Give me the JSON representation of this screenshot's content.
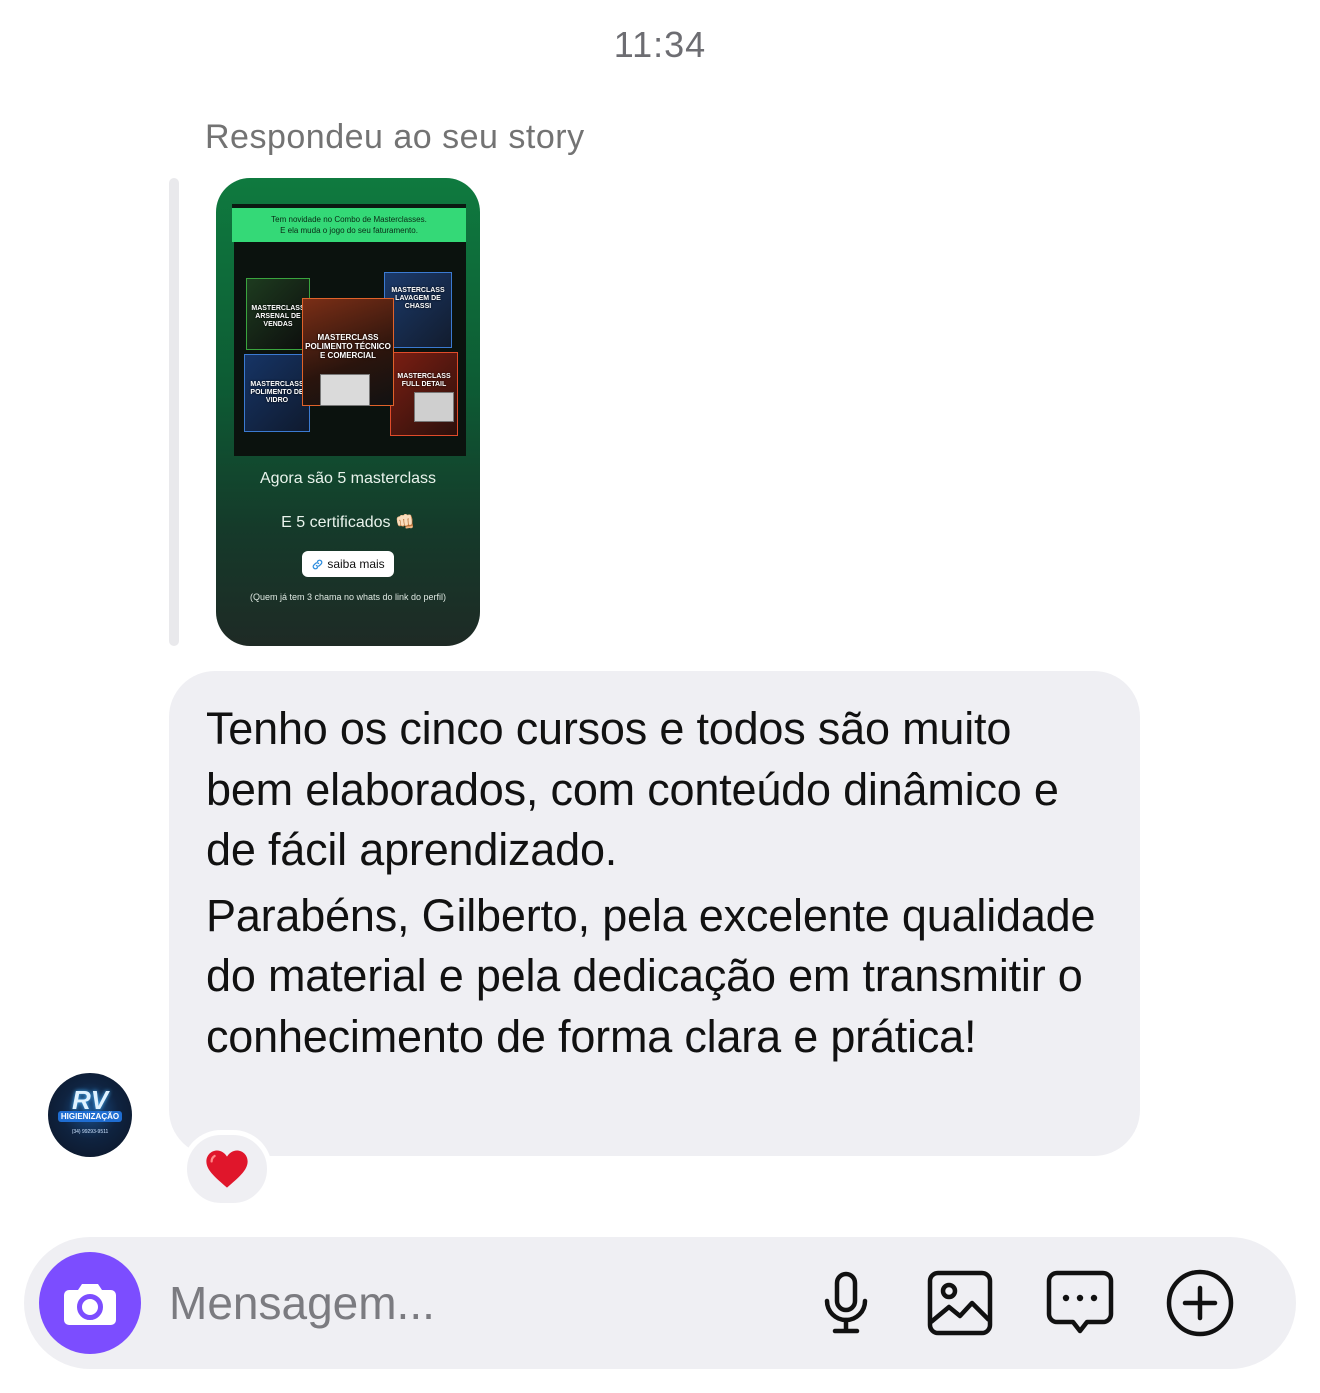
{
  "header": {
    "time": "11:34"
  },
  "thread": {
    "reply_context": "Respondeu ao seu story",
    "story": {
      "banner_line1": "Tem novidade no Combo de Masterclasses.",
      "banner_line2": "E ela muda o jogo do seu faturamento.",
      "cards": [
        "MASTERCLASS ARSENAL DE VENDAS",
        "MASTERCLASS LAVAGEM DE CHASSI",
        "MASTERCLASS POLIMENTO TÉCNICO E COMERCIAL",
        "MASTERCLASS POLIMENTO DE VIDRO",
        "MASTERCLASS FULL DETAIL"
      ],
      "line1": "Agora são 5 masterclass",
      "line2": "E 5 certificados 👊🏻",
      "link_label": "saiba mais",
      "note": "(Quem já tem 3 chama no whats do link do perfil)"
    },
    "message": {
      "paragraph1": "Tenho os cinco cursos e todos são muito bem elaborados, com conteúdo dinâmico e de fácil aprendizado.",
      "paragraph2": "Parabéns, Gilberto, pela excelente qualidade do material e pela dedicação em transmitir o conhecimento de forma clara e prática!"
    },
    "sender_avatar": {
      "logo_text": "RV",
      "logo_subtext": "HIGIENIZAÇÃO",
      "logo_phone": "(34) 99293-9511"
    },
    "reaction": {
      "icon": "red-heart-icon",
      "color": "#e0162b"
    }
  },
  "composer": {
    "placeholder": "Mensagem...",
    "camera_color": "#7c4dff",
    "icons": [
      "camera-icon",
      "microphone-icon",
      "gallery-icon",
      "sticker-icon",
      "plus-circle-icon"
    ]
  }
}
